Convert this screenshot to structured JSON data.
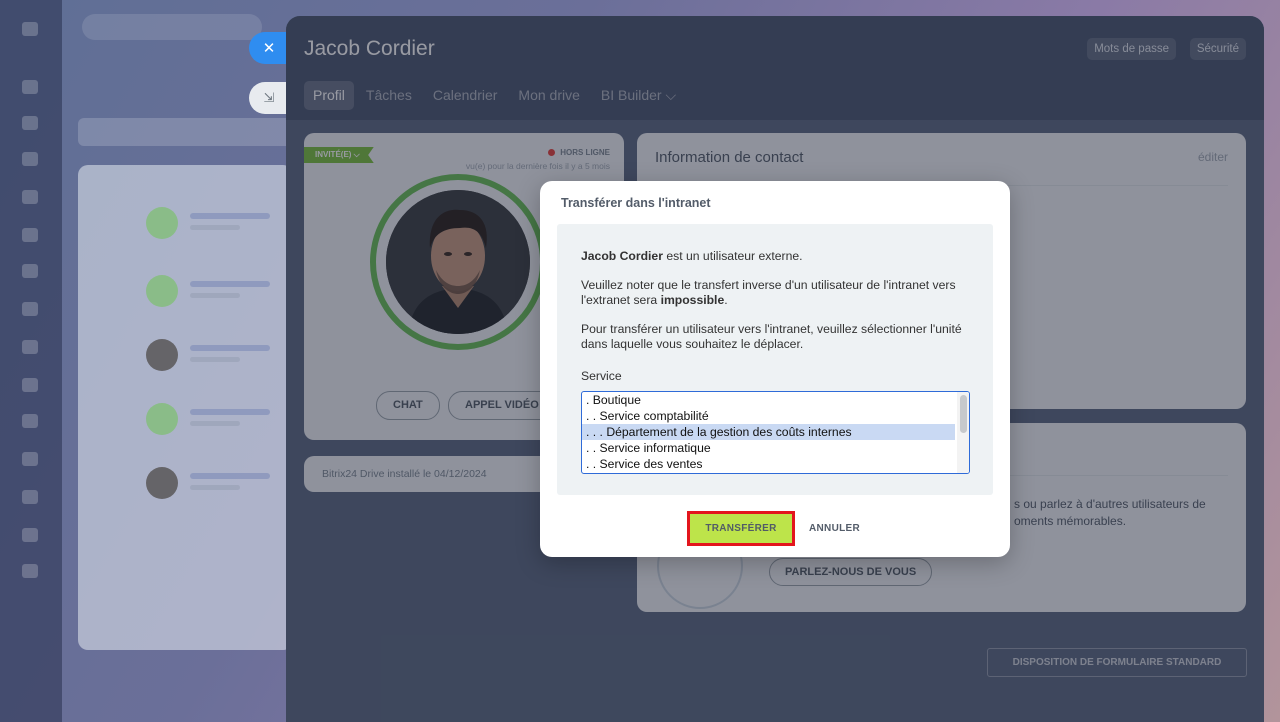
{
  "profile": {
    "name": "Jacob Cordier",
    "header_buttons": [
      "Mots de passe",
      "Sécurité"
    ],
    "tabs": [
      {
        "label": "Profil",
        "active": true
      },
      {
        "label": "Tâches",
        "active": false
      },
      {
        "label": "Calendrier",
        "active": false
      },
      {
        "label": "Mon drive",
        "active": false
      },
      {
        "label": "BI Builder ⌵",
        "active": false
      }
    ],
    "badge": "INVITÉ(E) ⌵",
    "status": "HORS LIGNE",
    "last_seen": "vu(e) pour la dernière fois il y a 5 mois",
    "chat_button": "CHAT",
    "video_button": "APPEL VIDÉO",
    "drive_info": "Bitrix24 Drive installé le 04/12/2024",
    "contact_title": "Information de contact",
    "contact_edit": "éditer",
    "about_text_line1": "s ou parlez à d'autres utilisateurs de",
    "about_text_line2": "oments mémorables.",
    "tell_us_button": "PARLEZ-NOUS DE VOUS",
    "standard_layout_button": "DISPOSITION DE FORMULAIRE STANDARD"
  },
  "dialog": {
    "title": "Transférer dans l'intranet",
    "p1_bold": "Jacob Cordier",
    "p1_rest": " est un utilisateur externe.",
    "p2_start": "Veuillez noter que le transfert inverse d'un utilisateur de l'intranet vers l'extranet sera ",
    "p2_bold": "impossible",
    "p2_end": ".",
    "p3": "Pour transférer un utilisateur vers l'intranet, veuillez sélectionner l'unité dans laquelle vous souhaitez le déplacer.",
    "service_label": "Service",
    "options": [
      {
        "label": ". Boutique",
        "selected": false
      },
      {
        "label": ". . Service comptabilité",
        "selected": false
      },
      {
        "label": ". . . Département de la gestion des coûts internes",
        "selected": true
      },
      {
        "label": ". . Service informatique",
        "selected": false
      },
      {
        "label": ". . Service des ventes",
        "selected": false
      }
    ],
    "transfer_button": "TRANSFÉRER",
    "cancel_button": "ANNULER"
  },
  "colors": {
    "accent_blue": "#2f8df0",
    "transfer_green": "#bde44a",
    "highlight_red": "#e3161d",
    "status_red": "#e4413c",
    "avatar_ring_green": "#68bd57"
  }
}
